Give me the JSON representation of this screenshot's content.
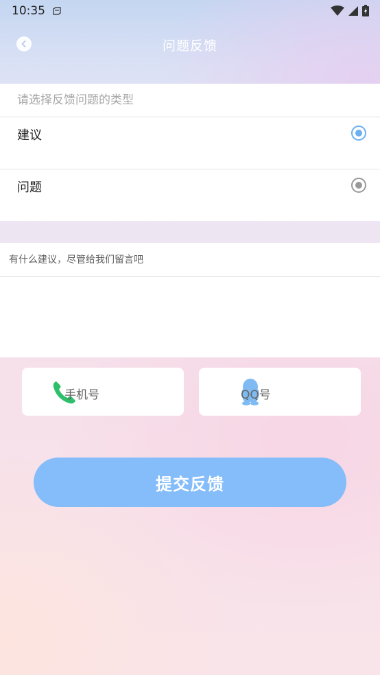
{
  "status_bar": {
    "time": "10:35"
  },
  "header": {
    "title": "问题反馈"
  },
  "feedback_type": {
    "placeholder": "请选择反馈问题的类型",
    "options": [
      {
        "label": "建议",
        "selected": true
      },
      {
        "label": "问题",
        "selected": false
      }
    ]
  },
  "message": {
    "placeholder": "有什么建议，尽管给我们留言吧"
  },
  "contact": {
    "phone_label": "手机号",
    "qq_label": "QQ号"
  },
  "submit": {
    "label": "提交反馈"
  },
  "colors": {
    "accent": "#84bdf9",
    "radio_selected": "#6ab0f2",
    "phone_icon": "#2dbf6a",
    "qq_icon": "#7fbaf2"
  }
}
